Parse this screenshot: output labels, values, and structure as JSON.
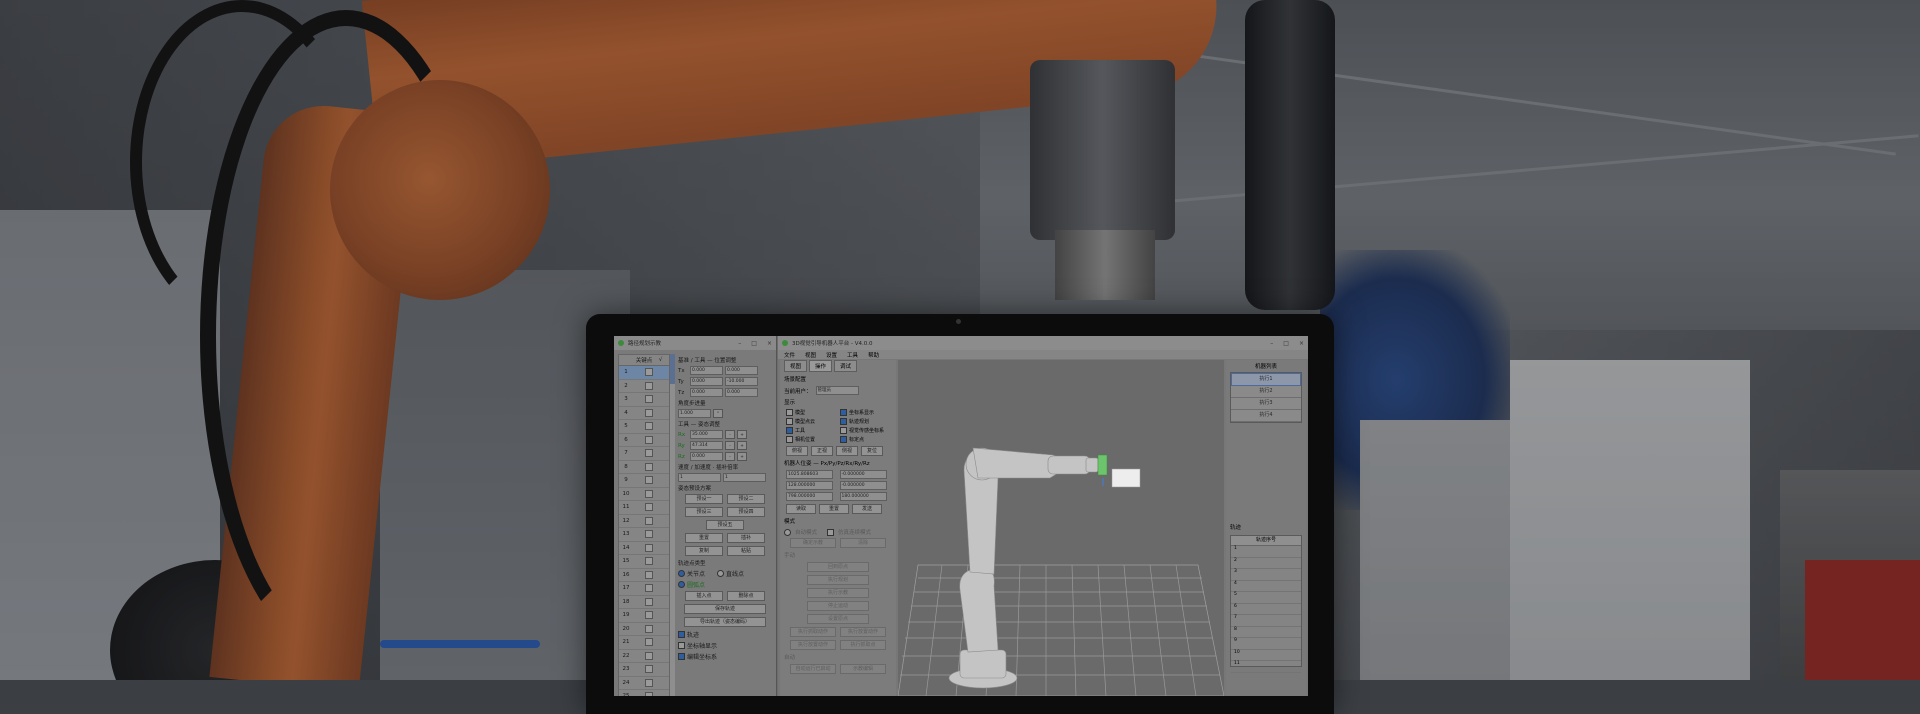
{
  "dialog": {
    "title": "路径规划示教",
    "list": {
      "headers": [
        "",
        "关键点",
        "√"
      ],
      "rows": [
        "1",
        "2",
        "3",
        "4",
        "5",
        "6",
        "7",
        "8",
        "9",
        "10",
        "11",
        "12",
        "13",
        "14",
        "15",
        "16",
        "17",
        "18",
        "19",
        "20",
        "21",
        "22",
        "23",
        "24",
        "25"
      ]
    },
    "pose_section": "基准 / 工具 — 位置调整",
    "pose_rows": [
      {
        "label": "Tx",
        "a": "0.000",
        "b": "0.000"
      },
      {
        "label": "Ty",
        "a": "0.000",
        "b": "-10.000"
      },
      {
        "label": "Tz",
        "a": "0.000",
        "b": "0.000"
      }
    ],
    "angle_section": "角度步进量",
    "angle_value": "1.000",
    "angle_unit": "°",
    "tool_section": "工具 — 姿态调整",
    "tool_rows": [
      {
        "label": "Rx",
        "value": "35.000"
      },
      {
        "label": "Ry",
        "value": "47.314"
      },
      {
        "label": "Rz",
        "value": "0.000"
      }
    ],
    "speed_section": "速度 / 加速度 · 插补倍率",
    "speed_a": "1",
    "speed_b": "1",
    "preset_section": "姿态预设方案",
    "preset_buttons": [
      [
        "预设一",
        "预设二"
      ],
      [
        "预设三",
        "预设四"
      ],
      [
        "预设五"
      ]
    ],
    "action_buttons": [
      [
        "重置",
        "插补"
      ],
      [
        "复制",
        "粘贴"
      ]
    ],
    "motion_section": "轨迹点类型",
    "motion_radio1": "关节点",
    "motion_radio2": "直线点",
    "motion_radio3": "圆弧点",
    "insert_button": "插入点",
    "delete_button": "删除点",
    "save_button": "保存轨迹",
    "export_button": "导出轨迹（姿态编码）",
    "checkbox1": "轨迹",
    "checkbox2": "坐标轴显示",
    "checkbox3": "编辑坐标系"
  },
  "main": {
    "title": "3D视觉引导机器人平台 - V4.0.0",
    "menu": [
      "文件",
      "视图",
      "设置",
      "工具",
      "帮助"
    ],
    "tabs": [
      "视图",
      "操作",
      "调试"
    ],
    "label_config": "场景配置",
    "label_user": "当前用户：",
    "user_value": "管理员",
    "display_section": "显示",
    "display_checks": [
      {
        "label": "模型",
        "on": false
      },
      {
        "label": "坐标系显示",
        "on": true
      },
      {
        "label": "模型点云",
        "on": false
      },
      {
        "label": "轨迹规划",
        "on": true
      },
      {
        "label": "工具",
        "on": true
      },
      {
        "label": "视觉传感坐标系",
        "on": false
      },
      {
        "label": "相机位置",
        "on": false
      },
      {
        "label": "标定点",
        "on": true
      }
    ],
    "view_buttons": [
      "俯视",
      "正视",
      "侧视",
      "复位"
    ],
    "coord_section": "机器人位姿 — Px/Py/Pz/Rx/Ry/Rz",
    "coord_values": [
      "1025.808603",
      "-0.000000",
      "128.000000",
      "-0.000000",
      "798.000000",
      "180.000000"
    ],
    "coord_buttons": [
      "读取",
      "重置",
      "发送"
    ],
    "mode_section": "模式",
    "mode_radio1": "自动模式",
    "mode_check": "仿真连续模式",
    "mode_disabled_btns": [
      "确定示教",
      "清除"
    ],
    "manual_section": "手动",
    "disabled_buttons": [
      "回到原点",
      "执行规划",
      "执行示教",
      "停止运动",
      "设置原点"
    ],
    "disabled_pairs": [
      [
        "执行抓取动作",
        "执行放置动作"
      ],
      [
        "执行放置动作",
        "执行抓取点"
      ]
    ],
    "auto_section": "自动",
    "bottom_buttons": [
      "自动运行已启动",
      "示教编辑"
    ],
    "side_head": "机器列表",
    "side_items": [
      "执行1",
      "执行2",
      "执行3",
      "执行4"
    ],
    "side_label": "轨迹",
    "table_head": "轨迹序号",
    "table_rows": [
      "1",
      "2",
      "3",
      "4",
      "5",
      "6",
      "7",
      "8",
      "9",
      "10",
      "11"
    ]
  }
}
